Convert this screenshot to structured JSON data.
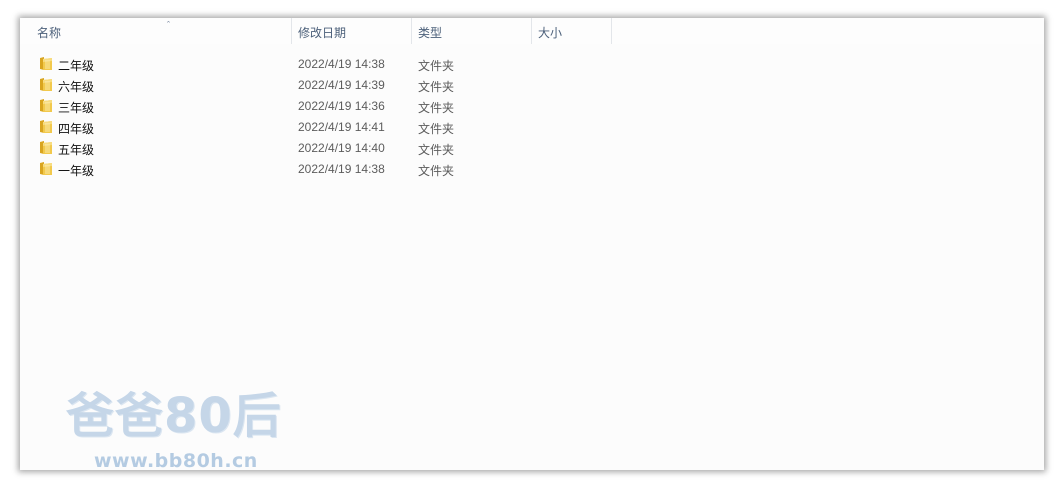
{
  "columns": {
    "name": "名称",
    "date": "修改日期",
    "type": "类型",
    "size": "大小",
    "sort_indicator": "ˆ"
  },
  "files": [
    {
      "name": "二年级",
      "date": "2022/4/19 14:38",
      "type": "文件夹",
      "icon": "folder-icon"
    },
    {
      "name": "六年级",
      "date": "2022/4/19 14:39",
      "type": "文件夹",
      "icon": "folder-icon"
    },
    {
      "name": "三年级",
      "date": "2022/4/19 14:36",
      "type": "文件夹",
      "icon": "folder-icon"
    },
    {
      "name": "四年级",
      "date": "2022/4/19 14:41",
      "type": "文件夹",
      "icon": "folder-icon"
    },
    {
      "name": "五年级",
      "date": "2022/4/19 14:40",
      "type": "文件夹",
      "icon": "folder-icon"
    },
    {
      "name": "一年级",
      "date": "2022/4/19 14:38",
      "type": "文件夹",
      "icon": "folder-icon"
    }
  ],
  "watermark": {
    "title": "爸爸80后",
    "url": "www.bb80h.cn"
  },
  "colors": {
    "header_text": "#4c607a",
    "folder_body": "#f2c94c",
    "folder_dark": "#d9a520",
    "watermark": "#c5d6e8"
  }
}
